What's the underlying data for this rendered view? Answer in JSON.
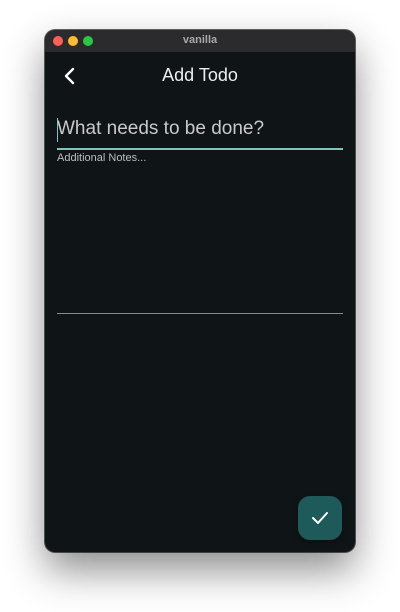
{
  "window": {
    "title": "vanilla"
  },
  "appbar": {
    "title": "Add Todo",
    "back_icon": "chevron-left-icon"
  },
  "form": {
    "task_placeholder": "What needs to be done?",
    "task_value": "",
    "notes_placeholder": "Additional Notes...",
    "notes_value": ""
  },
  "fab": {
    "icon": "check-icon"
  },
  "colors": {
    "background": "#0f1517",
    "accent": "#7fc5bd",
    "fab": "#1f5a5a",
    "text": "#eeeeee"
  }
}
